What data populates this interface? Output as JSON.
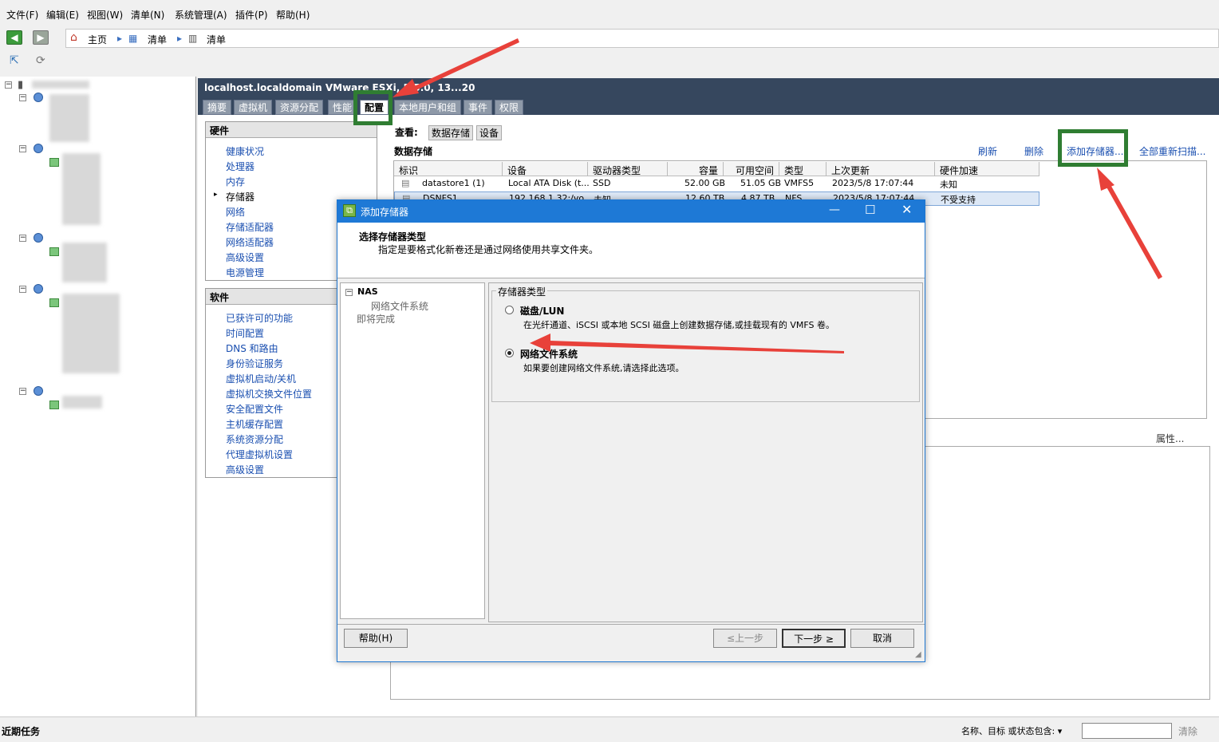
{
  "menu": [
    "文件(F)",
    "编辑(E)",
    "视图(W)",
    "清单(N)",
    "系统管理(A)",
    "插件(P)",
    "帮助(H)"
  ],
  "breadcrumb": {
    "home": "主页",
    "item1": "清单",
    "item2": "清单"
  },
  "host_title": "localhost.localdomain VMware ESXi, 5.5.0, 13...20",
  "tabs": [
    "摘要",
    "虚拟机",
    "资源分配",
    "性能",
    "配置",
    "本地用户和组",
    "事件",
    "权限"
  ],
  "hardware": {
    "title": "硬件",
    "items": [
      "健康状况",
      "处理器",
      "内存",
      "存储器",
      "网络",
      "存储适配器",
      "网络适配器",
      "高级设置",
      "电源管理"
    ]
  },
  "software": {
    "title": "软件",
    "items": [
      "已获许可的功能",
      "时间配置",
      "DNS 和路由",
      "身份验证服务",
      "虚拟机启动/关机",
      "虚拟机交换文件位置",
      "安全配置文件",
      "主机缓存配置",
      "系统资源分配",
      "代理虚拟机设置",
      "高级设置"
    ]
  },
  "view": {
    "label": "查看:",
    "opt1": "数据存储",
    "opt2": "设备"
  },
  "datastore": {
    "title": "数据存储",
    "actions": {
      "refresh": "刷新",
      "delete": "删除",
      "add": "添加存储器...",
      "rescan": "全部重新扫描..."
    },
    "columns": [
      "标识",
      "设备",
      "驱动器类型",
      "容量",
      "可用空间",
      "类型",
      "上次更新",
      "硬件加速"
    ],
    "rows": [
      [
        "datastore1 (1)",
        "Local ATA Disk (t...",
        "SSD",
        "52.00 GB",
        "51.05 GB",
        "VMFS5",
        "2023/5/8 17:07:44",
        "未知"
      ],
      [
        "DSNFS1",
        "192.168.1.32:/vo...",
        "未知",
        "12.60 TB",
        "4.87 TB",
        "NFS",
        "2023/5/8 17:07:44",
        "不受支持"
      ]
    ],
    "properties": "属性..."
  },
  "dialog": {
    "title": "添加存储器",
    "heading": "选择存储器类型",
    "subheading": "指定是要格式化新卷还是通过网络使用共享文件夹。",
    "nav": {
      "group": "NAS",
      "step1": "网络文件系统",
      "step2": "即将完成"
    },
    "fieldset_label": "存储器类型",
    "option1": {
      "label": "磁盘/LUN",
      "desc": "在光纤通道、iSCSI 或本地 SCSI 磁盘上创建数据存储,或挂载现有的 VMFS 卷。"
    },
    "option2": {
      "label": "网络文件系统",
      "desc": "如果要创建网络文件系统,请选择此选项。"
    },
    "buttons": {
      "help": "帮助(H)",
      "back": "≤上一步",
      "next": "下一步 ≥",
      "cancel": "取消"
    }
  },
  "status": {
    "recent": "近期任务",
    "filter_label": "名称、目标 或状态包含: ▾",
    "clear": "清除"
  },
  "colors": {
    "accent": "#1e79d6",
    "annotation_red": "#e8413a",
    "highlight_green": "#2f7d32"
  }
}
